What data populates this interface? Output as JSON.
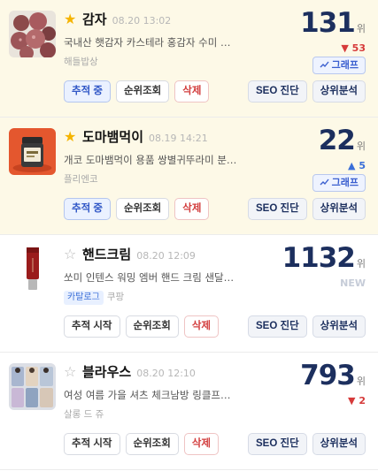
{
  "items": [
    {
      "name": "감자",
      "date": "08.20 13:02",
      "description": "국내산 햇감자 카스테라 홍감자 수미 …",
      "seller": "해들밥상",
      "catalog_badge": "",
      "rank": "131",
      "rank_unit": "위",
      "delta": "▼ 53",
      "graph_label": "그래프",
      "actions": {
        "track": "추적 중",
        "rank_check": "순위조회",
        "delete": "삭제",
        "seo": "SEO 진단",
        "top_analysis": "상위분석"
      }
    },
    {
      "name": "도마뱀먹이",
      "date": "08.19 14:21",
      "description": "개코 도마뱀먹이 용품 쌍별귀뚜라미 분…",
      "seller": "플리엔코",
      "catalog_badge": "",
      "rank": "22",
      "rank_unit": "위",
      "delta": "▲ 5",
      "graph_label": "그래프",
      "actions": {
        "track": "추적 중",
        "rank_check": "순위조회",
        "delete": "삭제",
        "seo": "SEO 진단",
        "top_analysis": "상위분석"
      }
    },
    {
      "name": "핸드크림",
      "date": "08.20 12:09",
      "description": "쏘미 인텐스 워밍 엠버 핸드 크림 샌달…",
      "seller": "쿠팡",
      "catalog_badge": "카탈로그",
      "rank": "1132",
      "rank_unit": "위",
      "delta": "NEW",
      "graph_label": "",
      "actions": {
        "track": "추적 시작",
        "rank_check": "순위조회",
        "delete": "삭제",
        "seo": "SEO 진단",
        "top_analysis": "상위분석"
      }
    },
    {
      "name": "블라우스",
      "date": "08.20 12:10",
      "description": "여성 여름 가을 셔츠 체크남방 링클프…",
      "seller": "살롱 드 쥬",
      "catalog_badge": "",
      "rank": "793",
      "rank_unit": "위",
      "delta": "▼ 2",
      "graph_label": "",
      "actions": {
        "track": "추적 시작",
        "rank_check": "순위조회",
        "delete": "삭제",
        "seo": "SEO 진단",
        "top_analysis": "상위분석"
      }
    }
  ],
  "colors": {
    "starred_bg": "#fdf9e7",
    "rank": "#1c2f5e",
    "down": "#d63a3a",
    "up": "#3a6fd8",
    "star": "#f5b400"
  },
  "icons": {
    "starred": "star-filled-icon",
    "unstarred": "star-outline-icon",
    "graph": "chart-icon"
  }
}
